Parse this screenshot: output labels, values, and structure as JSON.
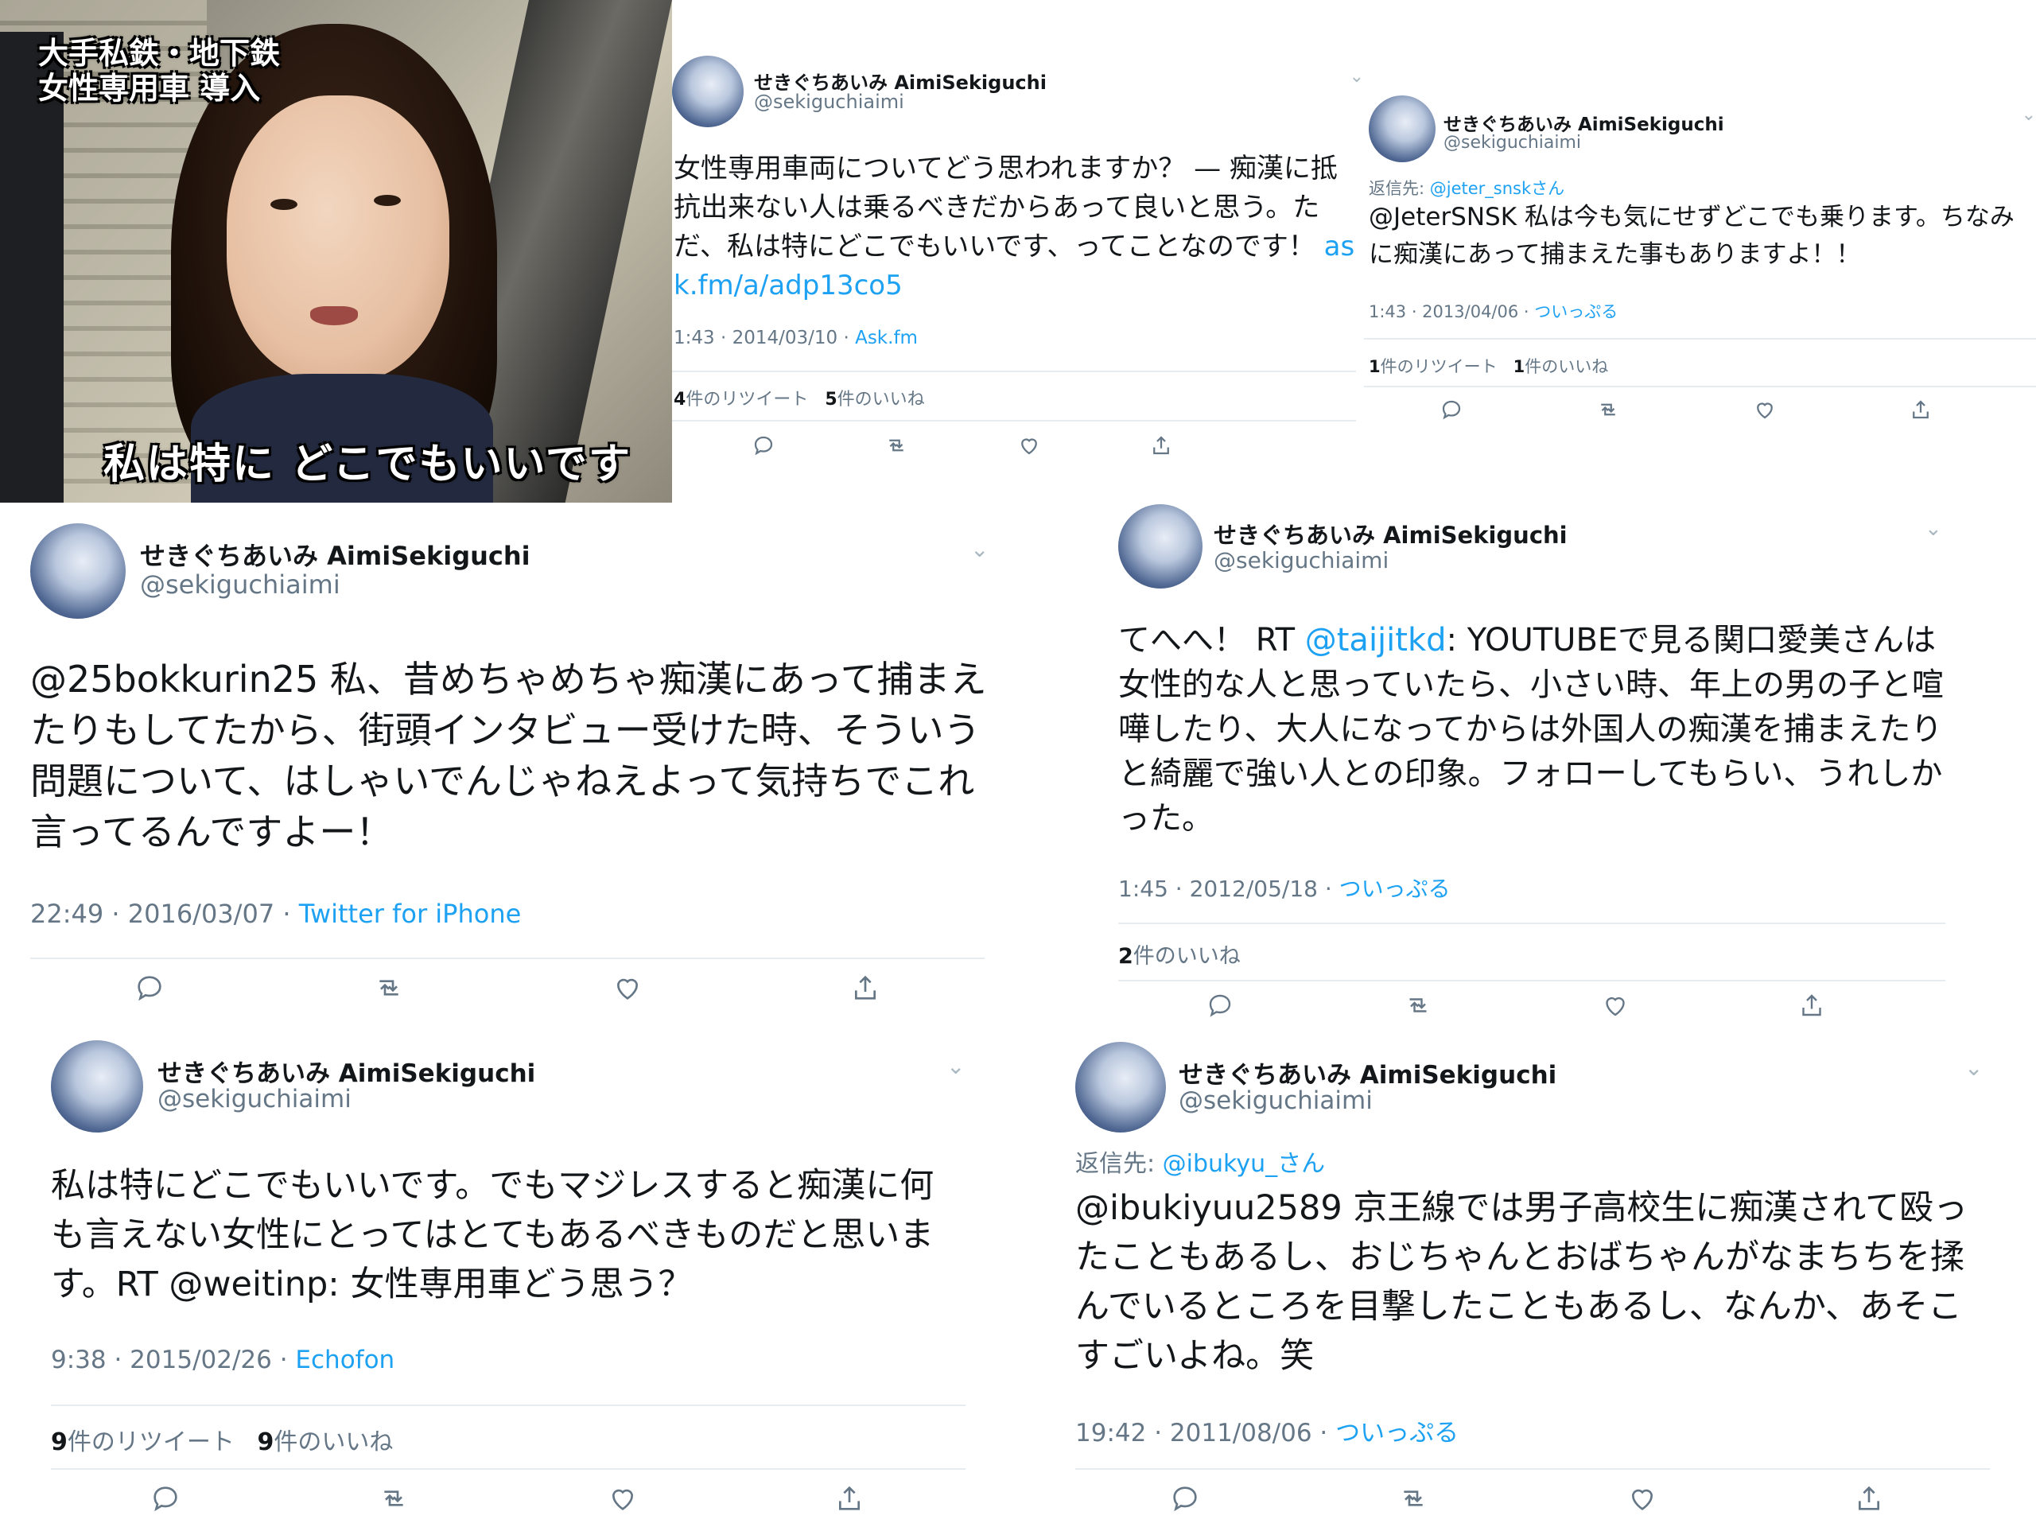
{
  "tv": {
    "caption_top": "大手私鉄・地下鉄\n女性専用車 導入",
    "caption_bottom": "私は特に どこでもいいです"
  },
  "author": {
    "name": "せきぐちあいみ AimiSekiguchi",
    "handle": "@sekiguchiaimi"
  },
  "tweets": [
    {
      "body_before": "女性専用車両についてどう思われますか？ — 痴漢に抵抗出来ない人は乗るべきだからあって良いと思う。ただ、私は特にどこでもいいです、ってことなのです！ ",
      "body_link": "ask.fm/a/adp13co5",
      "time": "1:43 · 2014/03/10 · ",
      "source": "Ask.fm",
      "retweets": "4",
      "retweets_label": "件のリツイート",
      "likes": "5",
      "likes_label": "件のいいね"
    },
    {
      "reply_label": "返信先: ",
      "reply_to": "@jeter_snskさん",
      "body": "@JeterSNSK 私は今も気にせずどこでも乗ります。ちなみに痴漢にあって捕まえた事もありますよ！！",
      "time": "1:43 · 2013/04/06 · ",
      "source": "ついっぷる",
      "retweets": "1",
      "retweets_label": "件のリツイート",
      "likes": "1",
      "likes_label": "件のいいね"
    },
    {
      "body": "@25bokkurin25 私、昔めちゃめちゃ痴漢にあって捕まえたりもしてたから、街頭インタビュー受けた時、そういう問題について、はしゃいでんじゃねえよって気持ちでこれ言ってるんですよー！",
      "time": "22:49 · 2016/03/07 · ",
      "source": "Twitter for iPhone"
    },
    {
      "body_before": "てへへ！ RT ",
      "body_mention": "@taijitkd",
      "body_after": ": YOUTUBEで見る関口愛美さんは女性的な人と思っていたら、小さい時、年上の男の子と喧嘩したり、大人になってからは外国人の痴漢を捕まえたりと綺麗で強い人との印象。フォローしてもらい、うれしかった。",
      "time": "1:45 · 2012/05/18 · ",
      "source": "ついっぷる",
      "likes": "2",
      "likes_label": "件のいいね"
    },
    {
      "body": "私は特にどこでもいいです。でもマジレスすると痴漢に何も言えない女性にとってはとてもあるべきものだと思います。RT @weitinp: 女性専用車どう思う？",
      "time": "9:38 · 2015/02/26 · ",
      "source": "Echofon",
      "retweets": "9",
      "retweets_label": "件のリツイート",
      "likes": "9",
      "likes_label": "件のいいね"
    },
    {
      "reply_label": "返信先: ",
      "reply_to": "@ibukyu_さん",
      "body": "@ibukiyuu2589 京王線では男子高校生に痴漢されて殴ったこともあるし、おじちゃんとおばちゃんがなまちちを揉んでいるところを目撃したこともあるし、なんか、あそこすごいよね。笑",
      "time": "19:42 · 2011/08/06 · ",
      "source": "ついっぷる"
    }
  ],
  "icons": [
    "reply-icon",
    "retweet-icon",
    "like-icon",
    "share-icon",
    "chevron-down-icon"
  ]
}
